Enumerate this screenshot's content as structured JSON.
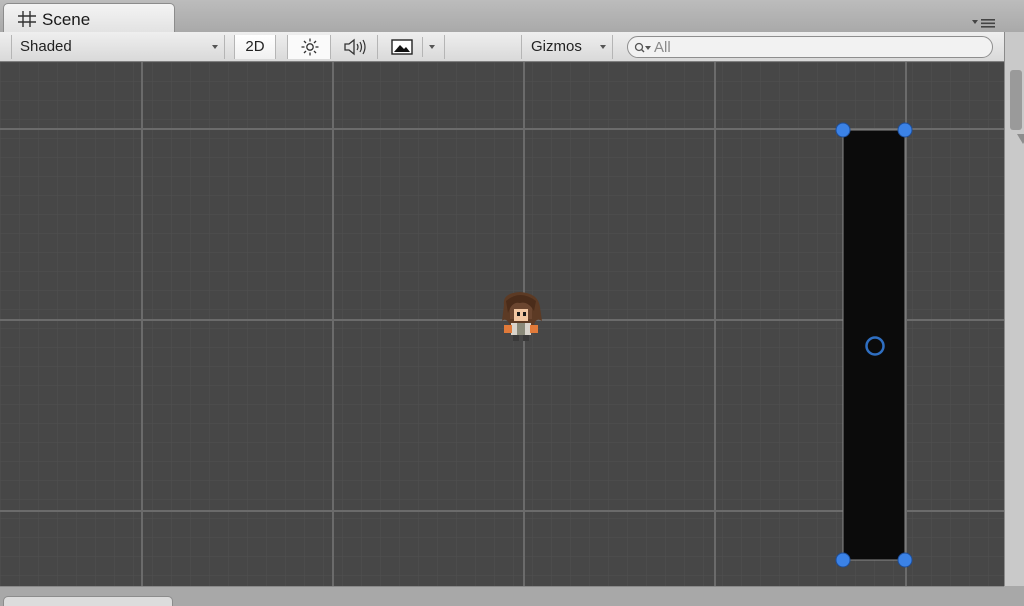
{
  "tab": {
    "title": "Scene",
    "icon": "grid-hash-icon"
  },
  "toolbar": {
    "draw_mode": "Shaded",
    "mode_2d": "2D",
    "lighting_icon": "sun-icon",
    "audio_icon": "speaker-icon",
    "effects_icon": "image-icon",
    "gizmos_label": "Gizmos",
    "search_placeholder": "All"
  },
  "scene": {
    "background_color": "#474747",
    "grid_color": "#5a5a5a",
    "grid_major_color": "#6e6e6e",
    "objects": [
      {
        "name": "character-sprite",
        "type": "sprite"
      },
      {
        "name": "black-rect-object",
        "type": "rect",
        "color": "#0b0b0b",
        "handle_color": "#3b82e6"
      }
    ]
  }
}
